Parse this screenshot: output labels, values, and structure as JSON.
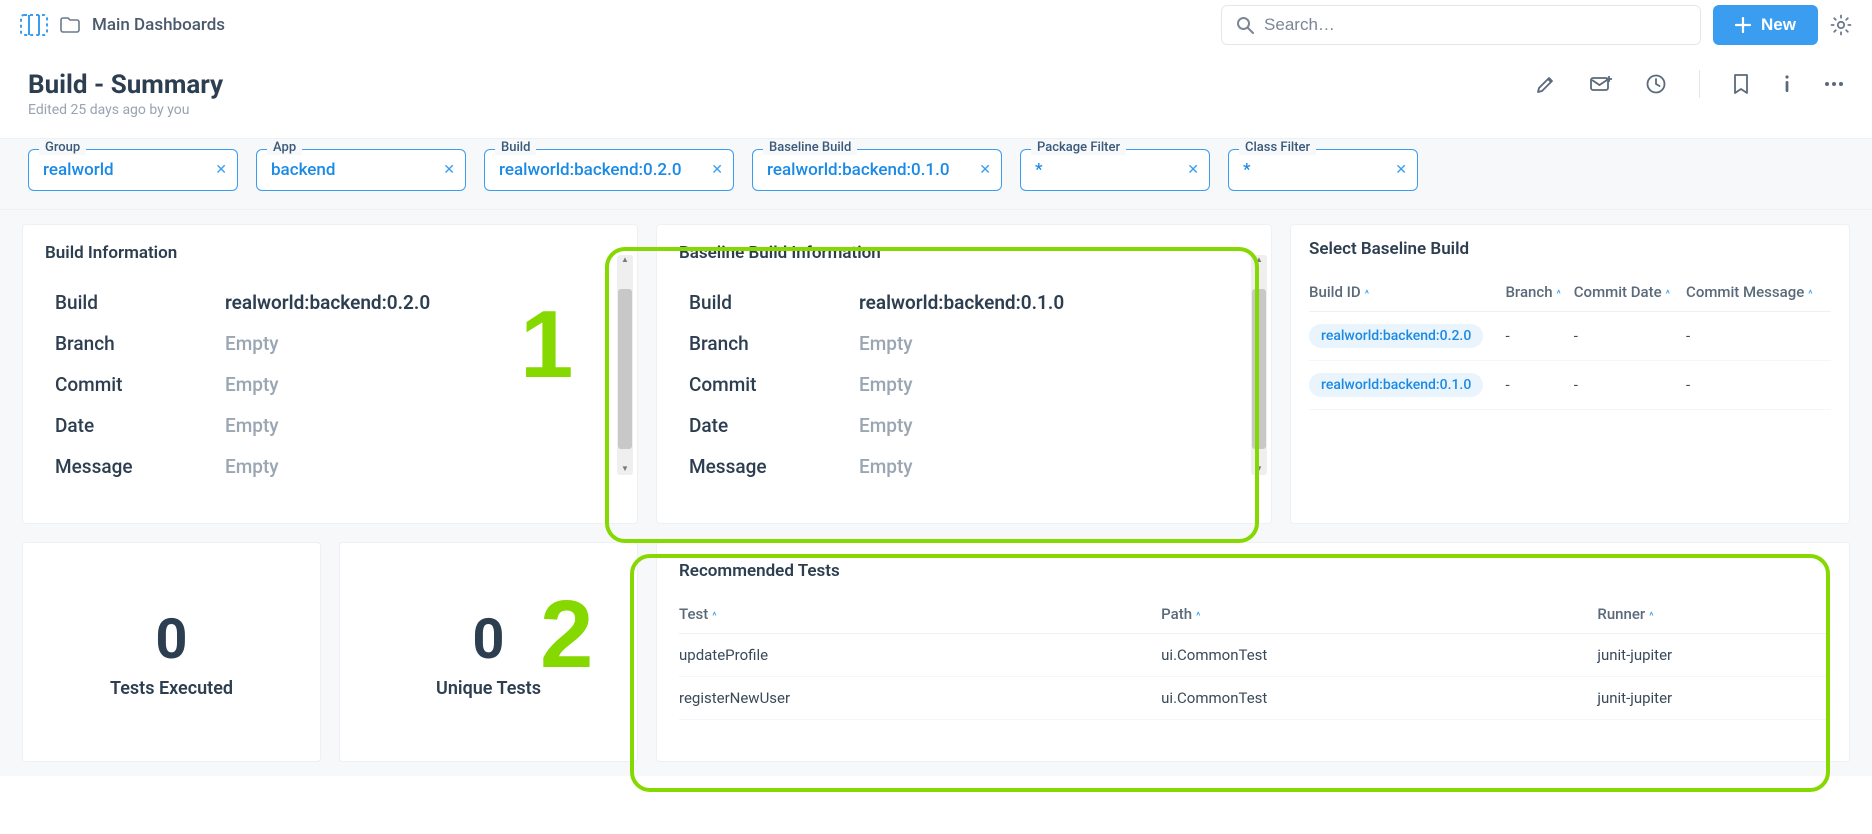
{
  "breadcrumb": "Main Dashboards",
  "search_placeholder": "Search…",
  "new_button": "New",
  "page_title": "Build - Summary",
  "page_subtitle": "Edited 25 days ago by you",
  "filters": {
    "group": {
      "label": "Group",
      "value": "realworld"
    },
    "app": {
      "label": "App",
      "value": "backend"
    },
    "build": {
      "label": "Build",
      "value": "realworld:backend:0.2.0"
    },
    "base": {
      "label": "Baseline Build",
      "value": "realworld:backend:0.1.0"
    },
    "pkg": {
      "label": "Package Filter",
      "value": "*"
    },
    "cls": {
      "label": "Class Filter",
      "value": "*"
    }
  },
  "build_info": {
    "title": "Build Information",
    "rows": {
      "build": {
        "k": "Build",
        "v": "realworld:backend:0.2.0",
        "empty": false
      },
      "branch": {
        "k": "Branch",
        "v": "Empty",
        "empty": true
      },
      "commit": {
        "k": "Commit",
        "v": "Empty",
        "empty": true
      },
      "date": {
        "k": "Date",
        "v": "Empty",
        "empty": true
      },
      "message": {
        "k": "Message",
        "v": "Empty",
        "empty": true
      }
    }
  },
  "baseline_info": {
    "title": "Baseline Build Information",
    "rows": {
      "build": {
        "k": "Build",
        "v": "realworld:backend:0.1.0",
        "empty": false
      },
      "branch": {
        "k": "Branch",
        "v": "Empty",
        "empty": true
      },
      "commit": {
        "k": "Commit",
        "v": "Empty",
        "empty": true
      },
      "date": {
        "k": "Date",
        "v": "Empty",
        "empty": true
      },
      "message": {
        "k": "Message",
        "v": "Empty",
        "empty": true
      }
    }
  },
  "select_baseline": {
    "title": "Select Baseline Build",
    "columns": {
      "id": "Build ID",
      "branch": "Branch",
      "cdate": "Commit Date",
      "cmsg": "Commit Message"
    },
    "rows": [
      {
        "id": "realworld:backend:0.2.0",
        "branch": "-",
        "cdate": "-",
        "cmsg": "-"
      },
      {
        "id": "realworld:backend:0.1.0",
        "branch": "-",
        "cdate": "-",
        "cmsg": "-"
      }
    ]
  },
  "stats": {
    "executed": {
      "num": "0",
      "label": "Tests Executed"
    },
    "unique": {
      "num": "0",
      "label": "Unique Tests"
    }
  },
  "rec_tests": {
    "title": "Recommended Tests",
    "columns": {
      "test": "Test",
      "path": "Path",
      "runner": "Runner"
    },
    "rows": [
      {
        "test": "updateProfile",
        "path": "ui.CommonTest",
        "runner": "junit-jupiter"
      },
      {
        "test": "registerNewUser",
        "path": "ui.CommonTest",
        "runner": "junit-jupiter"
      }
    ]
  },
  "annotations": {
    "one": "1",
    "two": "2"
  }
}
